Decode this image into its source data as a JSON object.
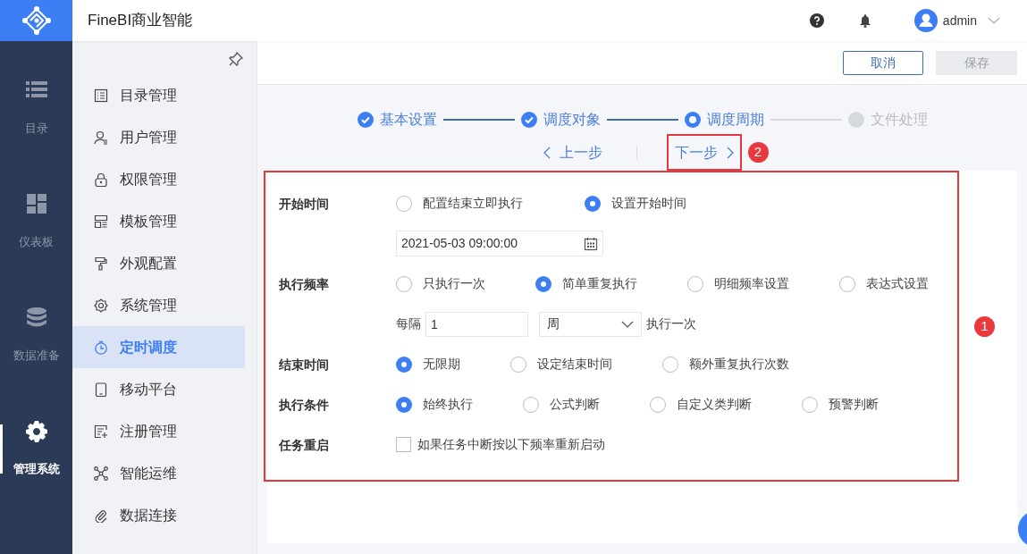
{
  "rail": {
    "items": [
      {
        "label": "目录",
        "selected": false
      },
      {
        "label": "仪表板",
        "selected": false
      },
      {
        "label": "数据准备",
        "selected": false
      },
      {
        "label": "管理系统",
        "selected": true
      }
    ]
  },
  "header": {
    "title": "FineBI商业智能",
    "user": "admin"
  },
  "sidebar": {
    "items": [
      {
        "label": "目录管理",
        "selected": false
      },
      {
        "label": "用户管理",
        "selected": false
      },
      {
        "label": "权限管理",
        "selected": false
      },
      {
        "label": "模板管理",
        "selected": false
      },
      {
        "label": "外观配置",
        "selected": false
      },
      {
        "label": "系统管理",
        "selected": false
      },
      {
        "label": "定时调度",
        "selected": true
      },
      {
        "label": "移动平台",
        "selected": false
      },
      {
        "label": "注册管理",
        "selected": false
      },
      {
        "label": "智能运维",
        "selected": false
      },
      {
        "label": "数据连接",
        "selected": false
      }
    ]
  },
  "toolbar": {
    "buttons": [
      {
        "label": "取消",
        "disabled": false
      },
      {
        "label": "保存",
        "disabled": true
      }
    ]
  },
  "steps": [
    {
      "label": "基本设置",
      "completed": true,
      "selected": false
    },
    {
      "label": "调度对象",
      "completed": true,
      "selected": false
    },
    {
      "label": "调度周期",
      "completed": false,
      "selected": true
    },
    {
      "label": "文件处理",
      "completed": false,
      "selected": false
    }
  ],
  "step_nav": {
    "previous": "上一步",
    "next": "下一步"
  },
  "form": {
    "rows": [
      {
        "kind": "radios",
        "label": "开始时间",
        "options": [
          {
            "label": "配置结束立即执行",
            "selected": false
          },
          {
            "label": "设置开始时间",
            "selected": true
          }
        ]
      },
      {
        "kind": "date",
        "value": "2021-05-03 09:00:00"
      },
      {
        "kind": "radios",
        "label": "执行频率",
        "options": [
          {
            "label": "只执行一次",
            "selected": false
          },
          {
            "label": "简单重复执行",
            "selected": true
          },
          {
            "label": "明细频率设置",
            "selected": false
          },
          {
            "label": "表达式设置",
            "selected": false
          }
        ]
      },
      {
        "kind": "interval",
        "prefix": "每隔",
        "value": "1",
        "unit": "周",
        "suffix": "执行一次"
      },
      {
        "kind": "radios",
        "label": "结束时间",
        "options": [
          {
            "label": "无限期",
            "selected": true
          },
          {
            "label": "设定结束时间",
            "selected": false
          },
          {
            "label": "额外重复执行次数",
            "selected": false
          }
        ]
      },
      {
        "kind": "radios",
        "label": "执行条件",
        "options": [
          {
            "label": "始终执行",
            "selected": true
          },
          {
            "label": "公式判断",
            "selected": false
          },
          {
            "label": "自定义类判断",
            "selected": false
          },
          {
            "label": "预警判断",
            "selected": false
          }
        ]
      },
      {
        "kind": "checkbox",
        "label": "任务重启",
        "text": "如果任务中断按以下频率重新启动",
        "checked": false
      }
    ]
  },
  "annotations": [
    {
      "text": "1"
    },
    {
      "text": "2"
    }
  ]
}
